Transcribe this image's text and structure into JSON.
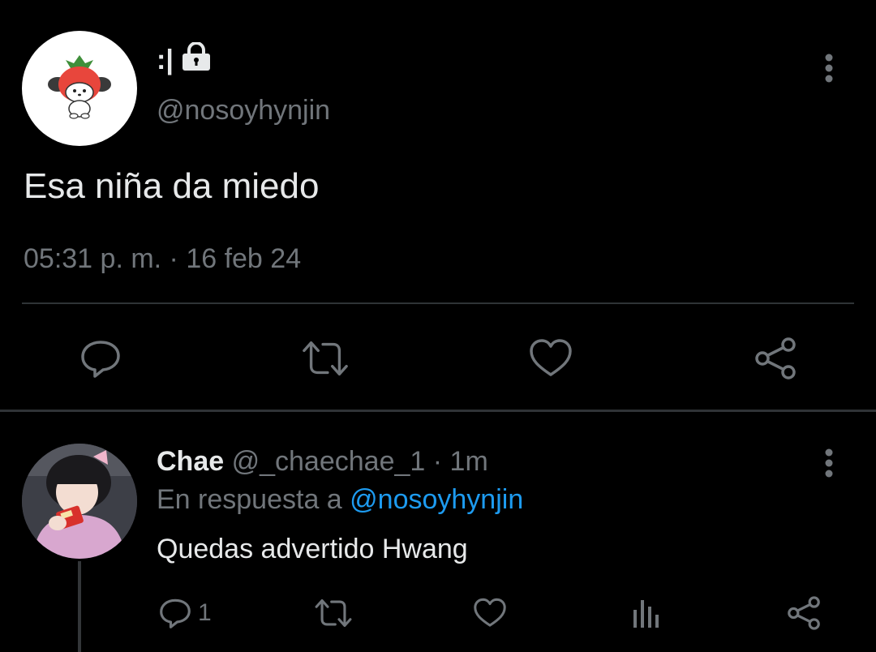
{
  "tweet": {
    "display_name": ":|",
    "handle": "@nosoyhynjin",
    "text": "Esa niña da miedo",
    "timestamp": "05:31 p. m. · 16 feb 24",
    "actions": {
      "reply_icon": "reply-icon",
      "retweet_icon": "retweet-icon",
      "like_icon": "heart-icon",
      "share_icon": "share-icon"
    },
    "more_icon": "more-vertical-icon",
    "lock_icon": "lock-icon"
  },
  "reply": {
    "display_name": "Chae",
    "handle": "@_chaechae_1",
    "time": "1m",
    "separator": "·",
    "reply_to_label": "En respuesta a",
    "reply_to_handle": "@nosoyhynjin",
    "text": "Quedas advertido Hwang",
    "reply_count": "1",
    "more_icon": "more-vertical-icon"
  },
  "colors": {
    "background": "#000000",
    "text": "#e7e9ea",
    "muted": "#71767b",
    "link": "#1d9bf0",
    "divider": "#2f3336"
  }
}
